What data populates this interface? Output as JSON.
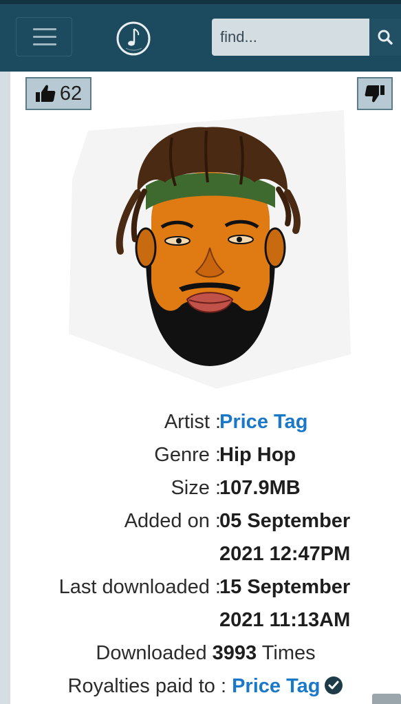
{
  "header": {
    "search": {
      "placeholder": "find...",
      "value": ""
    },
    "icons": {
      "menu": "hamburger-menu-icon",
      "logo": "music-note-logo",
      "search": "search-icon"
    }
  },
  "votes": {
    "likes": "62",
    "like_icon": "thumbs-up-icon",
    "dislike_icon": "thumbs-down-icon"
  },
  "details": {
    "artist_label": "Artist :",
    "artist": "Price Tag",
    "genre_label": "Genre :",
    "genre": "Hip Hop",
    "size_label": "Size :",
    "size": "107.9MB",
    "added_label": "Added on :",
    "added_line1": "05 September",
    "added_line2": "2021 12:47PM",
    "last_label": "Last downloaded :",
    "last_line1": "15 September",
    "last_line2": "2021 11:13AM",
    "downloaded_prefix": "Downloaded",
    "downloaded_count": "3993",
    "downloaded_suffix": "Times",
    "royalties_label": "Royalties paid to :",
    "royalties_artist": "Price Tag"
  },
  "colors": {
    "header": "#1c4a5e",
    "link": "#1a78c9",
    "vote_bg": "#b7c9d2"
  }
}
